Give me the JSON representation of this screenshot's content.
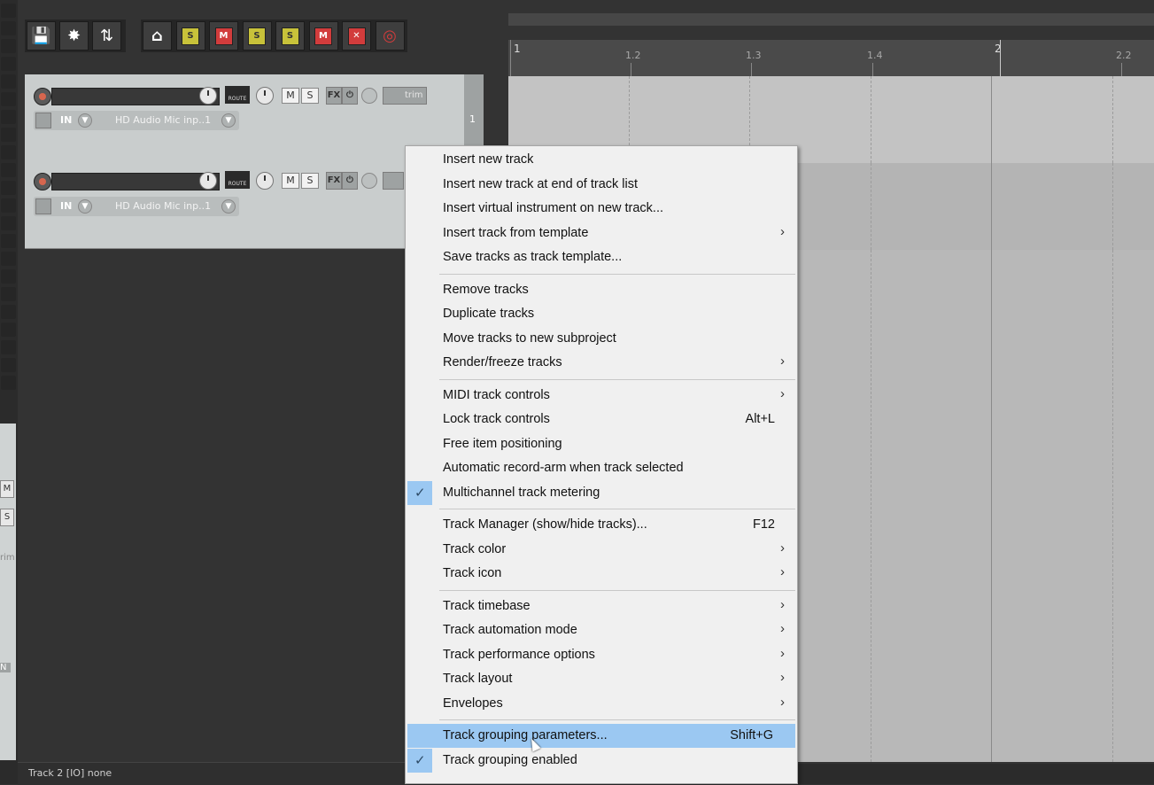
{
  "toolbar": {
    "group1": [
      {
        "name": "save-icon-button",
        "glyph": "💾"
      },
      {
        "name": "explode-icon-button",
        "glyph": "✸"
      },
      {
        "name": "open-icon-button",
        "glyph": "⇅"
      }
    ],
    "group2": [
      {
        "name": "home-icon-button",
        "glyph": "⌂",
        "color": "#ffffff",
        "bg": "#3e3e3e"
      },
      {
        "name": "solo-button",
        "glyph": "S",
        "color": "#333333",
        "bg": "#c8c23a"
      },
      {
        "name": "mute-button",
        "glyph": "M",
        "color": "#ffffff",
        "bg": "#d23c3c"
      },
      {
        "name": "solo-defeat-button",
        "glyph": "S",
        "color": "#333333",
        "bg": "#c8c23a"
      },
      {
        "name": "unsolo-all-button",
        "glyph": "S",
        "color": "#333333",
        "bg": "#c8c23a"
      },
      {
        "name": "unmute-all-button",
        "glyph": "M",
        "color": "#ffffff",
        "bg": "#d23c3c"
      },
      {
        "name": "clear-button",
        "glyph": "✕",
        "color": "#ffffff",
        "bg": "#d23c3c"
      },
      {
        "name": "record-clear-button",
        "glyph": "◎",
        "color": "#d23c3c",
        "bg": "#3e3e3e"
      }
    ]
  },
  "tracks": [
    {
      "number": "1",
      "route": "ROUTE",
      "mute": "M",
      "solo": "S",
      "fx": "FX",
      "trim": "trim",
      "in": "IN",
      "input": "HD Audio Mic inp..1"
    },
    {
      "number": "",
      "route": "ROUTE",
      "mute": "M",
      "solo": "S",
      "fx": "FX",
      "trim": "",
      "in": "IN",
      "input": "HD Audio Mic inp..1"
    }
  ],
  "mixer": {
    "mute": "M",
    "solo": "S",
    "trim": "rim",
    "in": "N"
  },
  "ruler": {
    "ticks": [
      "1",
      "1.2",
      "1.3",
      "1.4",
      "2",
      "2.2"
    ]
  },
  "status": {
    "text": "Track 2 [IO] none"
  },
  "menu": {
    "items": [
      {
        "label": "Insert new track"
      },
      {
        "label": "Insert new track at end of track list"
      },
      {
        "label": "Insert virtual instrument on new track..."
      },
      {
        "label": "Insert track from template",
        "submenu": true
      },
      {
        "label": "Save tracks as track template..."
      },
      {
        "separator": true
      },
      {
        "label": "Remove tracks"
      },
      {
        "label": "Duplicate tracks"
      },
      {
        "label": "Move tracks to new subproject"
      },
      {
        "label": "Render/freeze tracks",
        "submenu": true
      },
      {
        "separator": true
      },
      {
        "label": "MIDI track controls",
        "submenu": true
      },
      {
        "label": "Lock track controls",
        "shortcut": "Alt+L"
      },
      {
        "label": "Free item positioning"
      },
      {
        "label": "Automatic record-arm when track selected"
      },
      {
        "label": "Multichannel track metering",
        "checked": true
      },
      {
        "separator": true
      },
      {
        "label": "Track Manager (show/hide tracks)...",
        "shortcut": "F12"
      },
      {
        "label": "Track color",
        "submenu": true
      },
      {
        "label": "Track icon",
        "submenu": true
      },
      {
        "separator": true
      },
      {
        "label": "Track timebase",
        "submenu": true
      },
      {
        "label": "Track automation mode",
        "submenu": true
      },
      {
        "label": "Track performance options",
        "submenu": true
      },
      {
        "label": "Track layout",
        "submenu": true
      },
      {
        "label": "Envelopes",
        "submenu": true
      },
      {
        "separator": true
      },
      {
        "label": "Track grouping parameters...",
        "shortcut": "Shift+G",
        "highlighted": true
      },
      {
        "label": "Track grouping enabled",
        "checked": true
      }
    ],
    "arrow_glyph": "›",
    "check_glyph": "✓"
  }
}
